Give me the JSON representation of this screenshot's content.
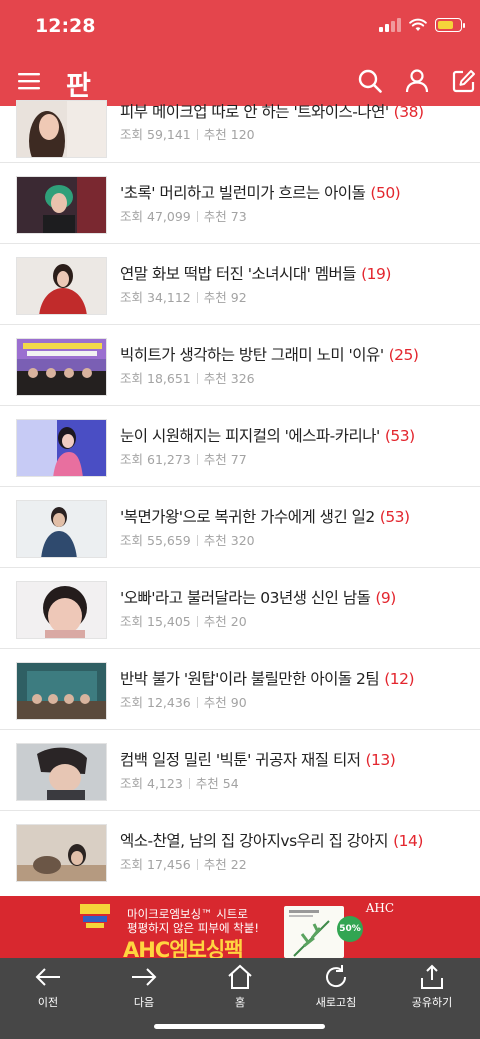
{
  "status_bar": {
    "time": "12:28"
  },
  "app": {
    "logo_text": "판"
  },
  "icons": {
    "menu": "hamburger-menu-icon",
    "search": "search-icon",
    "user": "user-icon",
    "write": "write-icon"
  },
  "colors": {
    "brand": "#e4454c",
    "count": "#e3262e",
    "bottom_bar": "#474747",
    "ad_background": "#d8282f"
  },
  "meta_labels": {
    "views": "조회",
    "recommends": "추천"
  },
  "articles": [
    {
      "title": "피부 메이크업 따로 안 하는 '트와이스-나연'",
      "count": "(38)",
      "views": "59,141",
      "recommends": "120"
    },
    {
      "title": "'초록' 머리하고 빌런미가 흐르는 아이돌",
      "count": "(50)",
      "views": "47,099",
      "recommends": "73"
    },
    {
      "title": "연말 화보 떡밥 터진 '소녀시대' 멤버들",
      "count": "(19)",
      "views": "34,112",
      "recommends": "92"
    },
    {
      "title": "빅히트가 생각하는 방탄 그래미 노미 '이유'",
      "count": "(25)",
      "views": "18,651",
      "recommends": "326"
    },
    {
      "title": "눈이 시원해지는 피지컬의 '에스파-카리나'",
      "count": "(53)",
      "views": "61,273",
      "recommends": "77"
    },
    {
      "title": "'복면가왕'으로 복귀한 가수에게 생긴 일2",
      "count": "(53)",
      "views": "55,659",
      "recommends": "320"
    },
    {
      "title": "'오빠'라고 불러달라는 03년생 신인 남돌",
      "count": "(9)",
      "views": "15,405",
      "recommends": "20"
    },
    {
      "title": "반박 불가 '원탑'이라 불릴만한 아이돌 2팀",
      "count": "(12)",
      "views": "12,436",
      "recommends": "90"
    },
    {
      "title": "컴백 일정 밀린 '빅툰' 귀공자 재질 티저",
      "count": "(13)",
      "views": "4,123",
      "recommends": "54"
    },
    {
      "title": "엑소-찬열, 남의 집 강아지vs우리 집 강아지",
      "count": "(14)",
      "views": "17,456",
      "recommends": "22"
    }
  ],
  "ad": {
    "line1": "마이크로엠보싱™ 시트로",
    "line2": "평평하지 않은 피부에 착붙!",
    "product": "AHC엠보싱팩",
    "logo": "AHC",
    "badge": "50%"
  },
  "bottom_nav": [
    {
      "label": "이전",
      "icon": "back-arrow-icon"
    },
    {
      "label": "다음",
      "icon": "forward-arrow-icon"
    },
    {
      "label": "홈",
      "icon": "home-icon"
    },
    {
      "label": "새로고침",
      "icon": "refresh-icon"
    },
    {
      "label": "공유하기",
      "icon": "share-icon"
    }
  ]
}
